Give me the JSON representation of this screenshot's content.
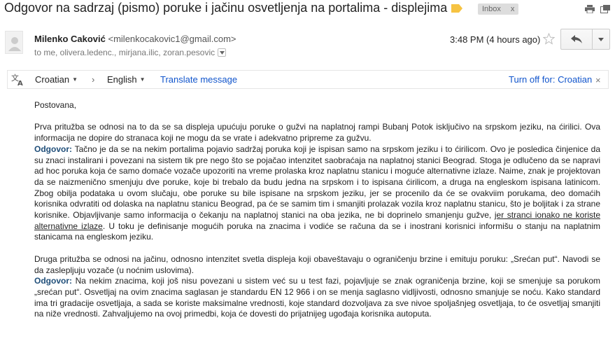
{
  "subject": "Odgovor na sadrzaj (pismo) poruke i jačinu osvetljenja na portalima - displejima",
  "label_chip": {
    "text": "Inbox",
    "close": "x"
  },
  "colors": {
    "label_tag": "#f6c342",
    "link": "#1155cc",
    "odgovor": "#1f4e79"
  },
  "sender": {
    "name": "Milenko Caković",
    "email": "<milenkocakovic1@gmail.com>",
    "to": "to me, olivera.ledenc., mirjana.ilic, zoran.pesovic"
  },
  "time": "3:48 PM (4 hours ago)",
  "translate": {
    "source": "Croatian",
    "arrow": "›",
    "target": "English",
    "translate_link": "Translate message",
    "turn_off": "Turn off for: Croatian",
    "close": "×"
  },
  "body": {
    "greeting": "Postovana,",
    "p1": "Prva pritužba se odnosi na to da se sa displeja upućuju poruke o gužvi na naplatnoj rampi Bubanj Potok isključivo na srpskom jeziku, na ćirilici. Ova informacija ne dopire do stranaca koji ne mogu da se vrate i adekvatno pripreme za gužvu.",
    "odgovor_label": "Odgovor:",
    "a1_part1": " Tačno je da se na nekim portalima pojavio sadržaj poruka koji je ispisan samo na srpskom jeziku i to ćirilicom. Ovo je posledica činjenice da su znaci instalirani i povezani na sistem tik pre nego što se pojačao intenzitet saobraćaja na naplatnoj stanici Beograd. Stoga je odlučeno da se napravi ad hoc poruka koja će samo domaće vozače upozoriti na vreme prolaska kroz naplatnu stanicu i moguće alternativne izlaze. Naime, znak je projektovan da se naizmenično smenjuju dve poruke, koje bi trebalo da budu jedna na srpskom i to ispisana ćirilicom, a druga na engleskom ispisana latinicom. Zbog obilja podataka u ovom slučaju, obe poruke su bile ispisane na srpskom jeziku, jer se procenilo da će se ovakviim porukama, deo domaćih korisnika odvratiti od dolaska na naplatnu stanicu Beograd, pa će se samim tim i smanjiti prolazak vozila kroz naplatnu stanicu, što je boljitak i za strane korisnike. Objavljivanje samo informacija o čekanju na naplatnoj stanici na oba jezika, ne bi doprinelo smanjenju gužve, ",
    "a1_underlined": "jer stranci ionako ne koriste alternativne izlaze",
    "a1_part2": ".  U toku je definisanje mogućih poruka na znacima i vodiće se računa da se i inostrani korisnici informišu o stanju na naplatnim stanicama na engleskom jeziku.",
    "p2": "Druga pritužba se odnosi na jačinu, odnosno intenzitet svetla displeja koji obaveštavaju o ograničenju brzine i emituju poruku: „Srećan put“. Navodi se da zaslepljuju vozače (u noćnim uslovima).",
    "a2": "  Na nekim znacima, koji još nisu povezani u sistem već su u test fazi, pojavljuje se znak ograničenja brzine, koji se smenjuje sa porukom „srećan put“. Osvetljaj na ovim znacima saglasan je standardu EN 12 966 i on se menja saglasno vidljivosti, odnosno smanjuje se noću. Kako standard ima tri gradacije osvetljaja, a sada se koriste maksimalne vrednosti, koje standard dozvoljava za sve nivoe spoljašnjeg osvetljaja, to će osvetljaj smanjiti na niže vrednosti. Zahvaljujemo na ovoj primedbi, koja će dovesti do prijatnijeg ugođaja  korisnika autoputa."
  }
}
